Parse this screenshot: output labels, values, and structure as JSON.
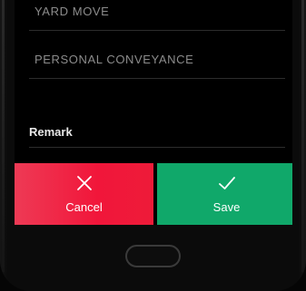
{
  "options": [
    {
      "label": "YARD MOVE"
    },
    {
      "label": "PERSONAL CONVEYANCE"
    }
  ],
  "remark": {
    "label": "Remark"
  },
  "actions": {
    "cancel_label": "Cancel",
    "save_label": "Save",
    "cancel_color": "#f1163a",
    "save_color": "#10a86a"
  }
}
